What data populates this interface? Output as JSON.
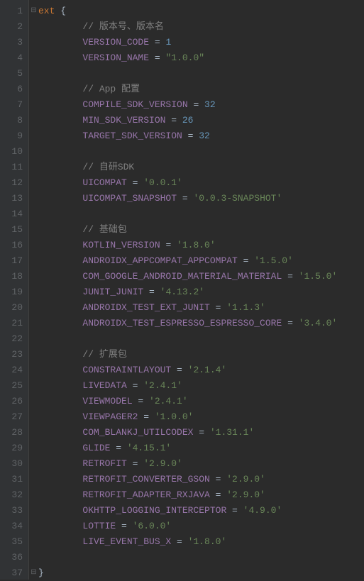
{
  "gutter": [
    "1",
    "2",
    "3",
    "4",
    "5",
    "6",
    "7",
    "8",
    "9",
    "10",
    "11",
    "12",
    "13",
    "14",
    "15",
    "16",
    "17",
    "18",
    "19",
    "20",
    "21",
    "22",
    "23",
    "24",
    "25",
    "26",
    "27",
    "28",
    "29",
    "30",
    "31",
    "32",
    "33",
    "34",
    "35",
    "36",
    "37"
  ],
  "fold_open": "⊟",
  "fold_close": "⊟",
  "lines": {
    "l1": {
      "kw": "ext",
      "brace": " {"
    },
    "l2": {
      "comment": "        // 版本号、版本名"
    },
    "l3": {
      "ident": "        VERSION_CODE",
      "eq": " = ",
      "val": "1"
    },
    "l4": {
      "ident": "        VERSION_NAME",
      "eq": " = ",
      "val": "\"1.0.0\""
    },
    "l6": {
      "comment": "        // App 配置"
    },
    "l7": {
      "ident": "        COMPILE_SDK_VERSION",
      "eq": " = ",
      "val": "32"
    },
    "l8": {
      "ident": "        MIN_SDK_VERSION",
      "eq": " = ",
      "val": "26"
    },
    "l9": {
      "ident": "        TARGET_SDK_VERSION",
      "eq": " = ",
      "val": "32"
    },
    "l11": {
      "comment": "        // 自研SDK"
    },
    "l12": {
      "ident": "        UICOMPAT",
      "eq": " = ",
      "val": "'0.0.1'"
    },
    "l13": {
      "ident": "        UICOMPAT_SNAPSHOT",
      "eq": " = ",
      "val": "'0.0.3-SNAPSHOT'"
    },
    "l15": {
      "comment": "        // 基础包"
    },
    "l16": {
      "ident": "        KOTLIN_VERSION",
      "eq": " = ",
      "val": "'1.8.0'"
    },
    "l17": {
      "ident": "        ANDROIDX_APPCOMPAT_APPCOMPAT",
      "eq": " = ",
      "val": "'1.5.0'"
    },
    "l18": {
      "ident": "        COM_GOOGLE_ANDROID_MATERIAL_MATERIAL",
      "eq": " = ",
      "val": "'1.5.0'"
    },
    "l19": {
      "ident": "        JUNIT_JUNIT",
      "eq": " = ",
      "val": "'4.13.2'"
    },
    "l20": {
      "ident": "        ANDROIDX_TEST_EXT_JUNIT",
      "eq": " = ",
      "val": "'1.1.3'"
    },
    "l21": {
      "ident": "        ANDROIDX_TEST_ESPRESSO_ESPRESSO_CORE",
      "eq": " = ",
      "val": "'3.4.0'"
    },
    "l23": {
      "comment": "        // 扩展包"
    },
    "l24": {
      "ident": "        CONSTRAINTLAYOUT",
      "eq": " = ",
      "val": "'2.1.4'"
    },
    "l25": {
      "ident": "        LIVEDATA",
      "eq": " = ",
      "val": "'2.4.1'"
    },
    "l26": {
      "ident": "        VIEWMODEL",
      "eq": " = ",
      "val": "'2.4.1'"
    },
    "l27": {
      "ident": "        VIEWPAGER2",
      "eq": " = ",
      "val": "'1.0.0'"
    },
    "l28": {
      "ident": "        COM_BLANKJ_UTILCODEX",
      "eq": " = ",
      "val": "'1.31.1'"
    },
    "l29": {
      "ident": "        GLIDE",
      "eq": " = ",
      "val": "'4.15.1'"
    },
    "l30": {
      "ident": "        RETROFIT",
      "eq": " = ",
      "val": "'2.9.0'"
    },
    "l31": {
      "ident": "        RETROFIT_CONVERTER_GSON",
      "eq": " = ",
      "val": "'2.9.0'"
    },
    "l32": {
      "ident": "        RETROFIT_ADAPTER_RXJAVA",
      "eq": " = ",
      "val": "'2.9.0'"
    },
    "l33": {
      "ident": "        OKHTTP_LOGGING_INTERCEPTOR",
      "eq": " = ",
      "val": "'4.9.0'"
    },
    "l34": {
      "ident": "        LOTTIE",
      "eq": " = ",
      "val": "'6.0.0'"
    },
    "l35": {
      "ident": "        LIVE_EVENT_BUS_X",
      "eq": " = ",
      "val": "'1.8.0'"
    },
    "l37": {
      "brace": "}"
    }
  }
}
